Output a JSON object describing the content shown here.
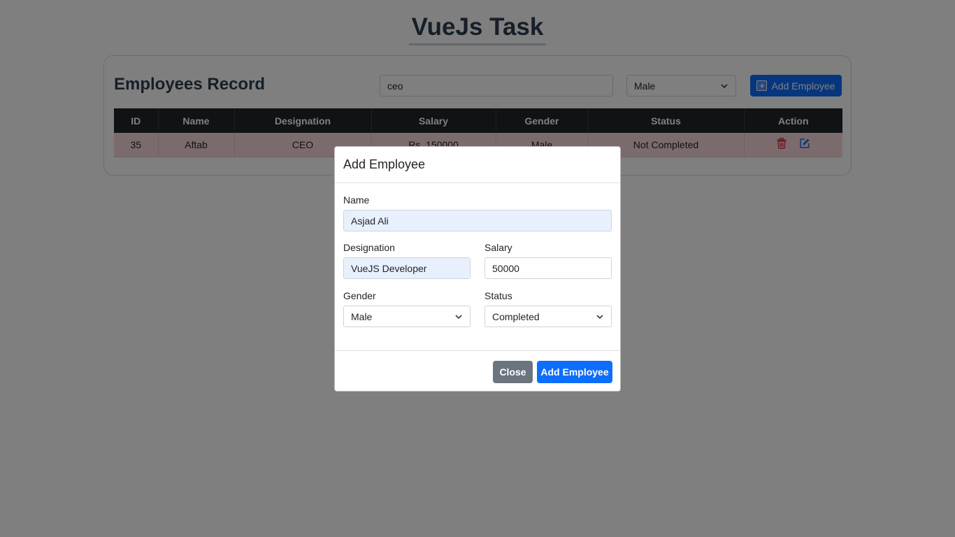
{
  "page": {
    "title": "VueJs Task"
  },
  "records": {
    "heading": "Employees Record",
    "search_value": "ceo",
    "gender_filter": "Male",
    "add_button_label": "Add Employee",
    "columns": [
      "ID",
      "Name",
      "Designation",
      "Salary",
      "Gender",
      "Status",
      "Action"
    ],
    "rows": [
      {
        "id": "35",
        "name": "Aftab",
        "designation": "CEO",
        "salary": "Rs. 150000",
        "gender": "Male",
        "status": "Not Completed"
      }
    ]
  },
  "modal": {
    "title": "Add Employee",
    "name_label": "Name",
    "name_value": "Asjad Ali",
    "designation_label": "Designation",
    "designation_value": "VueJS Developer",
    "salary_label": "Salary",
    "salary_value": "50000",
    "gender_label": "Gender",
    "gender_value": "Male",
    "status_label": "Status",
    "status_value": "Completed",
    "close_label": "Close",
    "submit_label": "Add Employee"
  },
  "colors": {
    "primary": "#0d6efd",
    "secondary": "#6c757d",
    "danger": "#dc3545",
    "table_header": "#212529",
    "row_highlight": "#f8d7da"
  },
  "icons": {
    "add": "plus-square-icon",
    "delete": "trash-icon",
    "edit": "edit-icon",
    "dropdown": "chevron-down-icon"
  }
}
